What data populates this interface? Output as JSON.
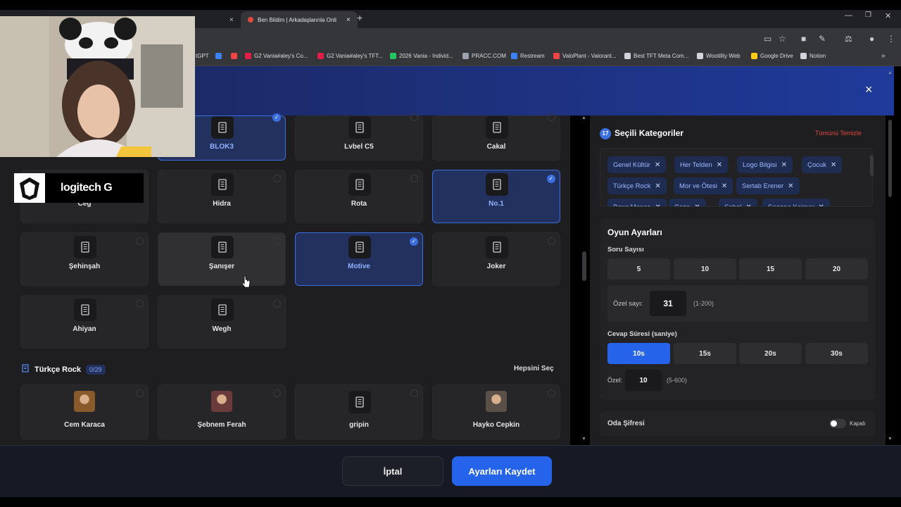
{
  "browser": {
    "tab_active": "Ben Bildim | Arkadaşlarınla Onli",
    "new_tab": "+",
    "close_tab": "×",
    "bookmarks": [
      {
        "label": "tGPT",
        "color": "#999999"
      },
      {
        "label": "",
        "color": "#3b82f6"
      },
      {
        "label": "",
        "color": "#ef4444"
      },
      {
        "label": "G2 Vania#aley's Co...",
        "color": "#e11d48"
      },
      {
        "label": "G2 Vania#aley's TFT...",
        "color": "#e11d48"
      },
      {
        "label": "2026 Vania - Individ...",
        "color": "#22c55e"
      },
      {
        "label": "PRACC.COM",
        "color": "#9ca3af"
      },
      {
        "label": "Restream",
        "color": "#3b82f6"
      },
      {
        "label": "ValoPlant - Valorant...",
        "color": "#ef4444"
      },
      {
        "label": "Best TFT Meta Com...",
        "color": "#d1d5db"
      },
      {
        "label": "Wootility Web",
        "color": "#d1d5db"
      },
      {
        "label": "Google Drive",
        "color": "#facc15"
      },
      {
        "label": "Notion",
        "color": "#d1d5db"
      }
    ]
  },
  "modal": {
    "close": "×"
  },
  "left": {
    "cards": [
      {
        "label": "BLOK3",
        "state": "selected"
      },
      {
        "label": "Lvbel C5",
        "state": "normal"
      },
      {
        "label": "Cakal",
        "state": "normal"
      },
      {
        "label": "Ceg",
        "state": "normal"
      },
      {
        "label": "Hidra",
        "state": "normal"
      },
      {
        "label": "Rota",
        "state": "normal"
      },
      {
        "label": "No.1",
        "state": "selected"
      },
      {
        "label": "Şehinşah",
        "state": "normal"
      },
      {
        "label": "Şanışer",
        "state": "hover"
      },
      {
        "label": "Motive",
        "state": "selected"
      },
      {
        "label": "Joker",
        "state": "normal"
      },
      {
        "label": "Ahiyan",
        "state": "normal"
      },
      {
        "label": "Wegh",
        "state": "normal"
      }
    ],
    "section": {
      "title": "Türkçe Rock",
      "count": "0/29",
      "select_all": "Hepsini Seç"
    },
    "rock_cards": [
      {
        "label": "Cem Karaca",
        "avatar": "#8a5a2b"
      },
      {
        "label": "Şebnem Ferah",
        "avatar": "#6b3a3a"
      },
      {
        "label": "gripin",
        "avatar": ""
      },
      {
        "label": "Hayko Cepkin",
        "avatar": "#5a5048"
      }
    ]
  },
  "right": {
    "selected_count": "17",
    "selected_title": "Seçili Kategoriler",
    "clear_all": "Tümünü Temizle",
    "tags": [
      "Genel Kültür",
      "Her Telden",
      "Logo Bilgisi",
      "Çocuk",
      "Türkçe Rock",
      "Mor ve Ötesi",
      "Sertab Erener",
      "Barış Manço",
      "Ceza",
      "Sabel",
      "Sagopa Kajmer"
    ],
    "settings": {
      "title": "Oyun Ayarları",
      "question_count_label": "Soru Sayısı",
      "question_options": [
        "5",
        "10",
        "15",
        "20"
      ],
      "custom_count_label": "Özel sayı:",
      "custom_count_value": "31",
      "custom_count_range": "(1-200)",
      "answer_time_label": "Cevap Süresi (saniye)",
      "time_options": [
        "10s",
        "15s",
        "20s",
        "30s"
      ],
      "time_selected": "10s",
      "custom_time_label": "Özel:",
      "custom_time_value": "10",
      "custom_time_range": "(5-600)"
    },
    "password": {
      "label": "Oda Şifresi",
      "toggle_label": "Kapalı"
    }
  },
  "footer": {
    "cancel": "İptal",
    "save": "Ayarları Kaydet"
  },
  "overlay": {
    "logo_text": "logitech G"
  }
}
